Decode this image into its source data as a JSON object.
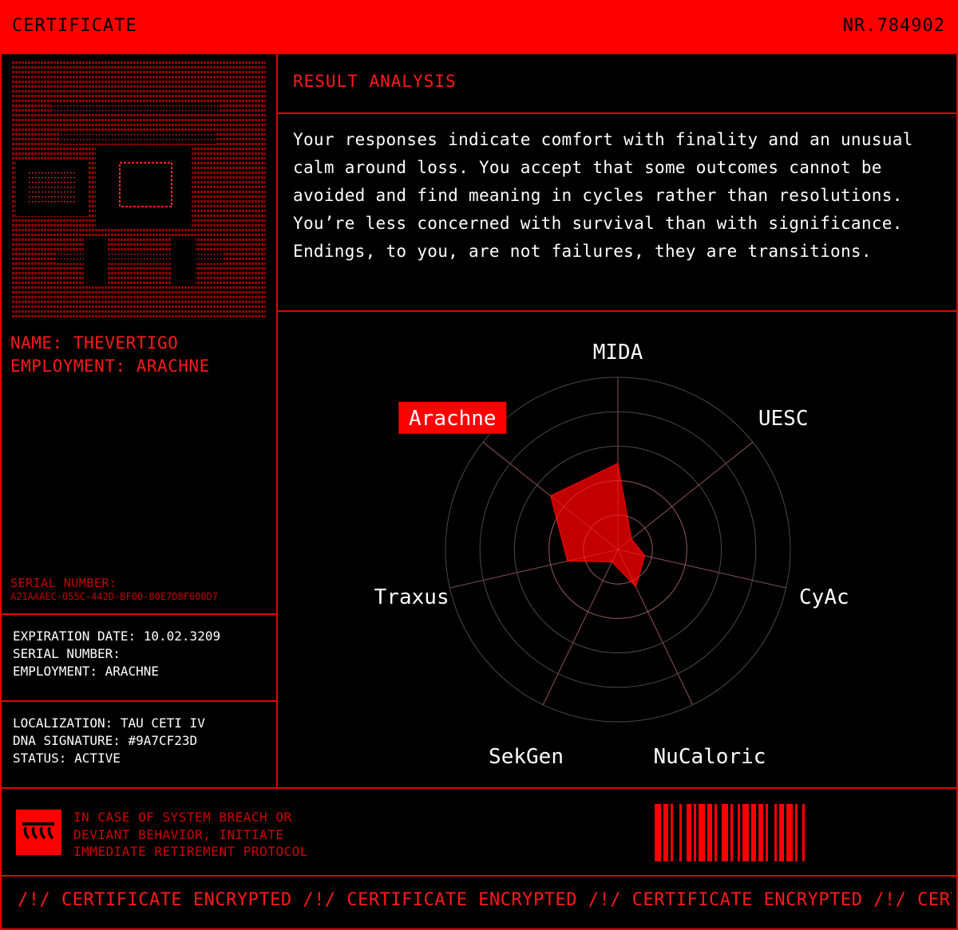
{
  "header": {
    "title": "CERTIFICATE",
    "number": "NR.784902"
  },
  "identity": {
    "name_line": "NAME: THEVERTIGO",
    "employment_line": "EMPLOYMENT: ARACHNE",
    "serial_label": "SERIAL NUMBER:",
    "serial_value": "A21AAAEC-055C-442D-BF00-80E7D8F600D7"
  },
  "info_block_1": {
    "expiration": "EXPIRATION DATE: 10.02.3209",
    "serial": "SERIAL NUMBER:",
    "employment": "EMPLOYMENT: ARACHNE"
  },
  "info_block_2": {
    "localization": "LOCALIZATION: TAU CETI IV",
    "dna": "DNA SIGNATURE: #9A7CF23D",
    "status": "STATUS: ACTIVE"
  },
  "result": {
    "title": "RESULT ANALYSIS",
    "body": "Your responses indicate comfort with finality and an unusual calm around loss. You accept that some outcomes cannot be avoided and find meaning in cycles rather than resolutions. You’re less concerned with survival than with significance. Endings, to you, are not failures, they are transitions."
  },
  "warning": {
    "line1": "IN CASE OF SYSTEM BREACH OR",
    "line2": "DEVIANT BEHAVIOR, INITIATE",
    "line3": "IMMEDIATE RETIREMENT PROTOCOL"
  },
  "ticker": "/!/ CERTIFICATE ENCRYPTED /!/ CERTIFICATE ENCRYPTED /!/ CERTIFICATE ENCRYPTED /!/ CERTIFICATE ENCRYPTED",
  "colors": {
    "accent": "#ff0000",
    "background": "#000000",
    "text": "#ffffff",
    "grid": "#555555",
    "fill": "#cc0000"
  },
  "icons": {
    "warning": "claw-marks-icon"
  },
  "chart_data": {
    "type": "radar",
    "categories": [
      "MIDA",
      "UESC",
      "CyAc",
      "NuCaloric",
      "SekGen",
      "Traxus",
      "Arachne"
    ],
    "highlighted": "Arachne",
    "rings": 5,
    "range": [
      0,
      5
    ],
    "values": [
      2.5,
      0.5,
      0.8,
      1.2,
      0.4,
      1.5,
      2.5
    ]
  }
}
